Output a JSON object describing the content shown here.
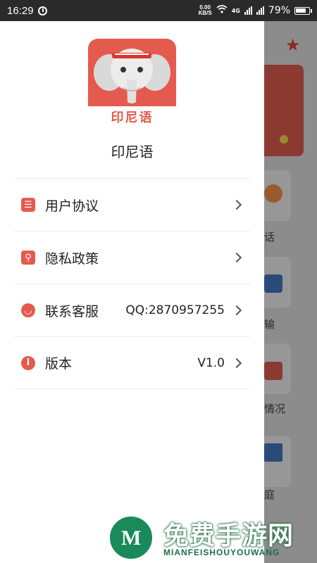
{
  "status_bar": {
    "time": "16:29",
    "net_speed_value": "0.00",
    "net_speed_unit": "KB/S",
    "network_type": "4G",
    "battery": "79%"
  },
  "drawer": {
    "logo_text": "印尼语",
    "app_name": "印尼语",
    "menu": [
      {
        "label": "用户协议",
        "value": "",
        "icon": "document-icon"
      },
      {
        "label": "隐私政策",
        "value": "",
        "icon": "lock-icon"
      },
      {
        "label": "联系客服",
        "value": "QQ:2870957255",
        "icon": "chat-icon"
      },
      {
        "label": "版本",
        "value": "V1.0",
        "icon": "info-icon"
      }
    ]
  },
  "background_app": {
    "labels": [
      "话",
      "输",
      "情况",
      "庭"
    ]
  },
  "watermark": {
    "cn": "免费手游网",
    "en": "MIANFEISHOUYOUWANG"
  },
  "colors": {
    "accent": "#e55a4e",
    "watermark_green": "#1d6e4a"
  }
}
